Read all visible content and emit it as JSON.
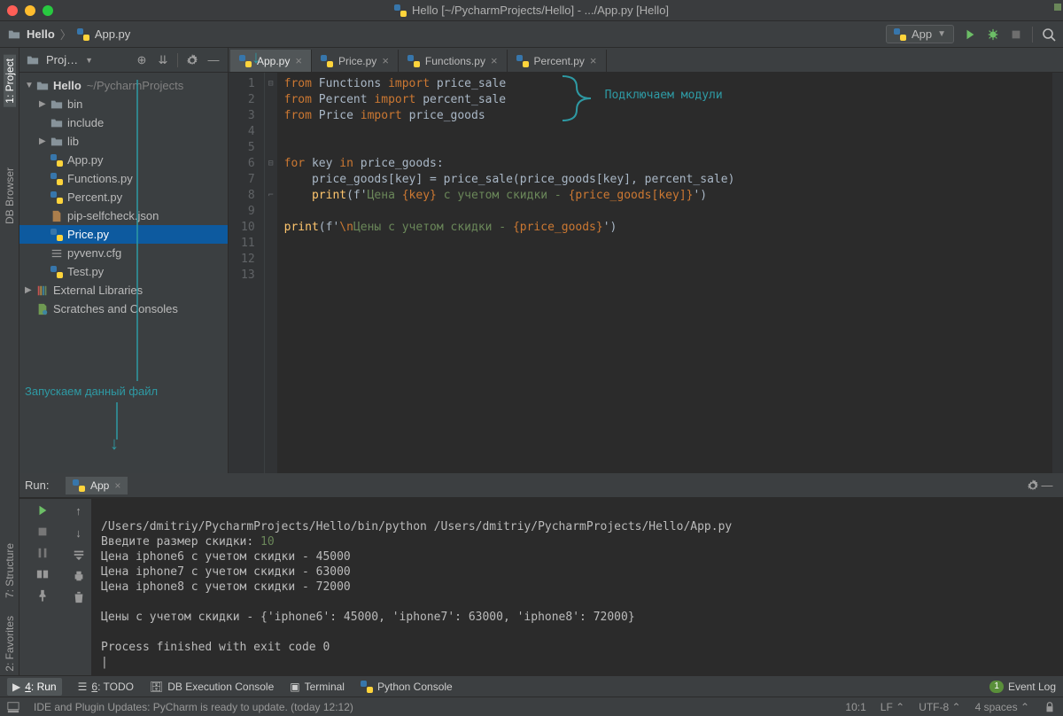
{
  "title": "Hello [~/PycharmProjects/Hello] - .../App.py [Hello]",
  "breadcrumbs": {
    "root": "Hello",
    "file": "App.py"
  },
  "toolbar": {
    "run_config": "App",
    "icons": {
      "run": "run-icon",
      "debug": "debug-icon",
      "stop": "stop-icon",
      "search": "search-icon"
    }
  },
  "left_rail": {
    "project": "1: Project",
    "db": "DB Browser"
  },
  "project_panel": {
    "title": "Proj…",
    "root": "Hello",
    "root_path": "~/PycharmProjects",
    "tree": {
      "bin": "bin",
      "include": "include",
      "lib": "lib",
      "files": [
        "App.py",
        "Functions.py",
        "Percent.py",
        "pip-selfcheck.json",
        "Price.py",
        "pyvenv.cfg",
        "Test.py"
      ],
      "ext_lib": "External Libraries",
      "scratches": "Scratches and Consoles"
    }
  },
  "tabs": [
    "App.py",
    "Price.py",
    "Functions.py",
    "Percent.py"
  ],
  "code": {
    "l1": {
      "kw1": "from",
      "m": "Functions",
      "kw2": "import",
      "n": "price_sale"
    },
    "l2": {
      "kw1": "from",
      "m": "Percent",
      "kw2": "import",
      "n": "percent_sale"
    },
    "l3": {
      "kw1": "from",
      "m": "Price",
      "kw2": "import",
      "n": "price_goods"
    },
    "l6": {
      "kw1": "for",
      "v": "key",
      "kw2": "in",
      "c": "price_goods:"
    },
    "l7": "    price_goods[key] = price_sale(price_goods[key], percent_sale)",
    "l8a": "print",
    "l8b": "(f'",
    "l8c": "Цена ",
    "l8k": "{key}",
    "l8d": " с учетом скидки - ",
    "l8e": "{price_goods[key]}",
    "l8f": "')",
    "l10a": "print",
    "l10b": "(f'",
    "l10c": "\\n",
    "l10d": "Цены с учетом скидки - ",
    "l10e": "{price_goods}",
    "l10f": "')"
  },
  "annotations": {
    "modules": "Подключаем модули",
    "run_file": "Запускаем данный файл"
  },
  "run": {
    "title": "Run:",
    "tab": "App",
    "lines": [
      "/Users/dmitriy/PycharmProjects/Hello/bin/python /Users/dmitriy/PycharmProjects/Hello/App.py",
      "Введите размер скидки: ",
      "10",
      "Цена iphone6 с учетом скидки - 45000",
      "Цена iphone7 с учетом скидки - 63000",
      "Цена iphone8 с учетом скидки - 72000",
      "",
      "Цены с учетом скидки - {'iphone6': 45000, 'iphone7': 63000, 'iphone8': 72000}",
      "",
      "Process finished with exit code 0"
    ]
  },
  "left_rail2": {
    "structure": "7: Structure",
    "favorites": "2: Favorites"
  },
  "bottom_tabs": {
    "run": "4: Run",
    "todo": "6: TODO",
    "db": "DB Execution Console",
    "terminal": "Terminal",
    "py": "Python Console",
    "event": "Event Log"
  },
  "status": {
    "msg": "IDE and Plugin Updates: PyCharm is ready to update. (today 12:12)",
    "pos": "10:1",
    "lf": "LF",
    "enc": "UTF-8",
    "indent": "4 spaces"
  }
}
